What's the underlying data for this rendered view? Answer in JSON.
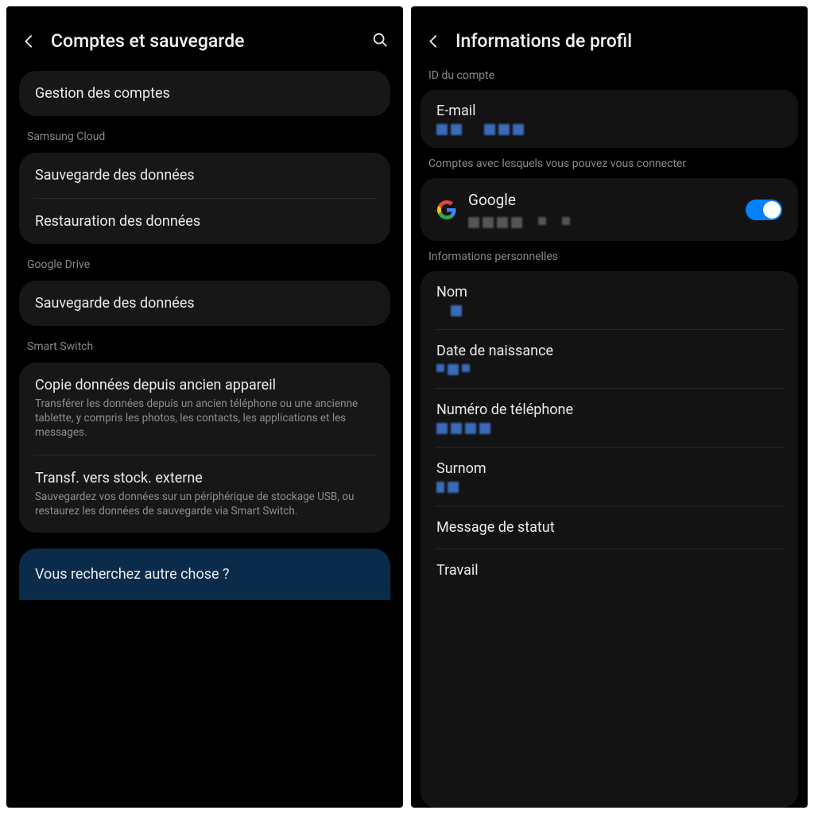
{
  "left": {
    "title": "Comptes et sauvegarde",
    "manage_accounts": "Gestion des comptes",
    "section_samsung_cloud": "Samsung Cloud",
    "backup_data": "Sauvegarde des données",
    "restore_data": "Restauration des données",
    "section_google_drive": "Google Drive",
    "gd_backup_data": "Sauvegarde des données",
    "section_smart_switch": "Smart Switch",
    "copy_title": "Copie données depuis ancien appareil",
    "copy_sub": "Transférer les données depuis un ancien téléphone ou une ancienne tablette, y compris les photos, les contacts, les applications et les messages.",
    "transfer_title": "Transf. vers stock. externe",
    "transfer_sub": "Sauvegardez vos données sur un périphérique de stockage USB, ou restaurez les données de sauvegarde via Smart Switch.",
    "footer": "Vous recherchez autre chose ?"
  },
  "right": {
    "title": "Informations de profil",
    "section_account_id": "ID du compte",
    "email_label": "E-mail",
    "section_connect": "Comptes avec lesquels vous pouvez vous connecter",
    "google_label": "Google",
    "section_personal": "Informations personnelles",
    "name_label": "Nom",
    "dob_label": "Date de naissance",
    "phone_label": "Numéro de téléphone",
    "nickname_label": "Surnom",
    "status_label": "Message de statut",
    "work_label": "Travail"
  }
}
